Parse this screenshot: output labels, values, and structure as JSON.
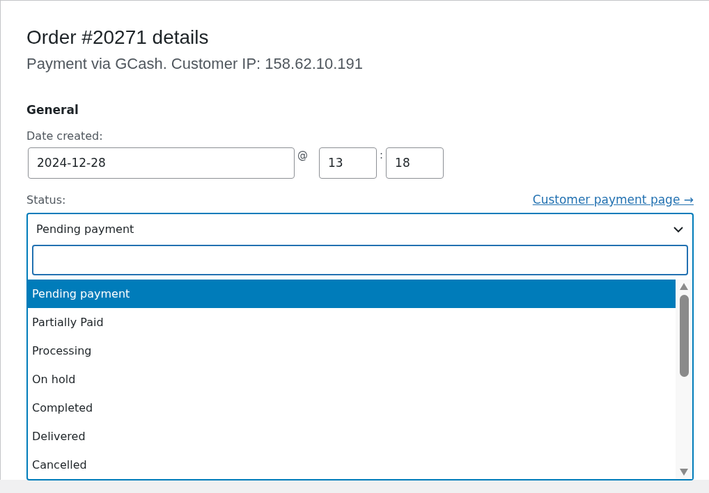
{
  "title": "Order #20271 details",
  "subtitle": "Payment via GCash. Customer IP: 158.62.10.191",
  "section": "General",
  "date_created": {
    "label": "Date created:",
    "date": "2024-12-28",
    "at": "@",
    "hour": "13",
    "separator": ":",
    "minute": "18"
  },
  "status": {
    "label": "Status:",
    "link": "Customer payment page →",
    "value": "Pending payment",
    "expanded": true,
    "options": [
      {
        "label": "Pending payment",
        "selected": true
      },
      {
        "label": "Partially Paid",
        "selected": false
      },
      {
        "label": "Processing",
        "selected": false
      },
      {
        "label": "On hold",
        "selected": false
      },
      {
        "label": "Completed",
        "selected": false
      },
      {
        "label": "Delivered",
        "selected": false
      },
      {
        "label": "Cancelled",
        "selected": false
      }
    ]
  }
}
